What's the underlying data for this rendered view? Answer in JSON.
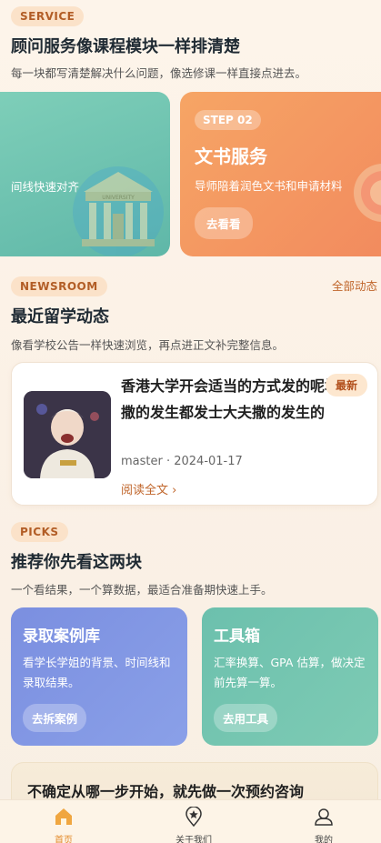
{
  "service": {
    "pill": "SERVICE",
    "title": "顾问服务像课程模块一样排清楚",
    "subtitle": "每一块都写清楚解决什么问题，像选修课一样直接点进去。",
    "cards": [
      {
        "desc": "间线快速对齐",
        "building_text": "UNIVERSITY",
        "color": "#6cc0ad"
      },
      {
        "step": "STEP 02",
        "title": "文书服务",
        "desc": "导师陪着润色文书和申请材料",
        "button": "去看看",
        "color": "#f49560"
      }
    ]
  },
  "newsroom": {
    "pill": "NEWSROOM",
    "all_link": "全部动态",
    "title": "最近留学动态",
    "subtitle": "像看学校公告一样快速浏览，再点进正文补完整信息。",
    "article": {
      "headline": "香港大学开会适当的方式发的呢地方撒的发生都发士大夫撒的发生的",
      "tag": "最新",
      "meta": "master · 2024-01-17",
      "read_more": "阅读全文 ›"
    }
  },
  "picks": {
    "pill": "PICKS",
    "title": "推荐你先看这两块",
    "subtitle": "一个看结果，一个算数据，最适合准备期快速上手。",
    "cards": [
      {
        "title": "录取案例库",
        "desc": "看学长学姐的背景、时间线和录取结果。",
        "button": "去拆案例",
        "color": "#7b8fe0"
      },
      {
        "title": "工具箱",
        "desc": "汇率换算、GPA 估算，做决定前先算一算。",
        "button": "去用工具",
        "color": "#6cc0ad"
      }
    ]
  },
  "consult": {
    "text": "不确定从哪一步开始，就先做一次预约咨询"
  },
  "tabbar": {
    "items": [
      {
        "label": "首页",
        "icon": "home-icon",
        "active": true
      },
      {
        "label": "关于我们",
        "icon": "location-star-icon",
        "active": false
      },
      {
        "label": "我的",
        "icon": "user-icon",
        "active": false
      }
    ],
    "active_color": "#e38a2a"
  }
}
